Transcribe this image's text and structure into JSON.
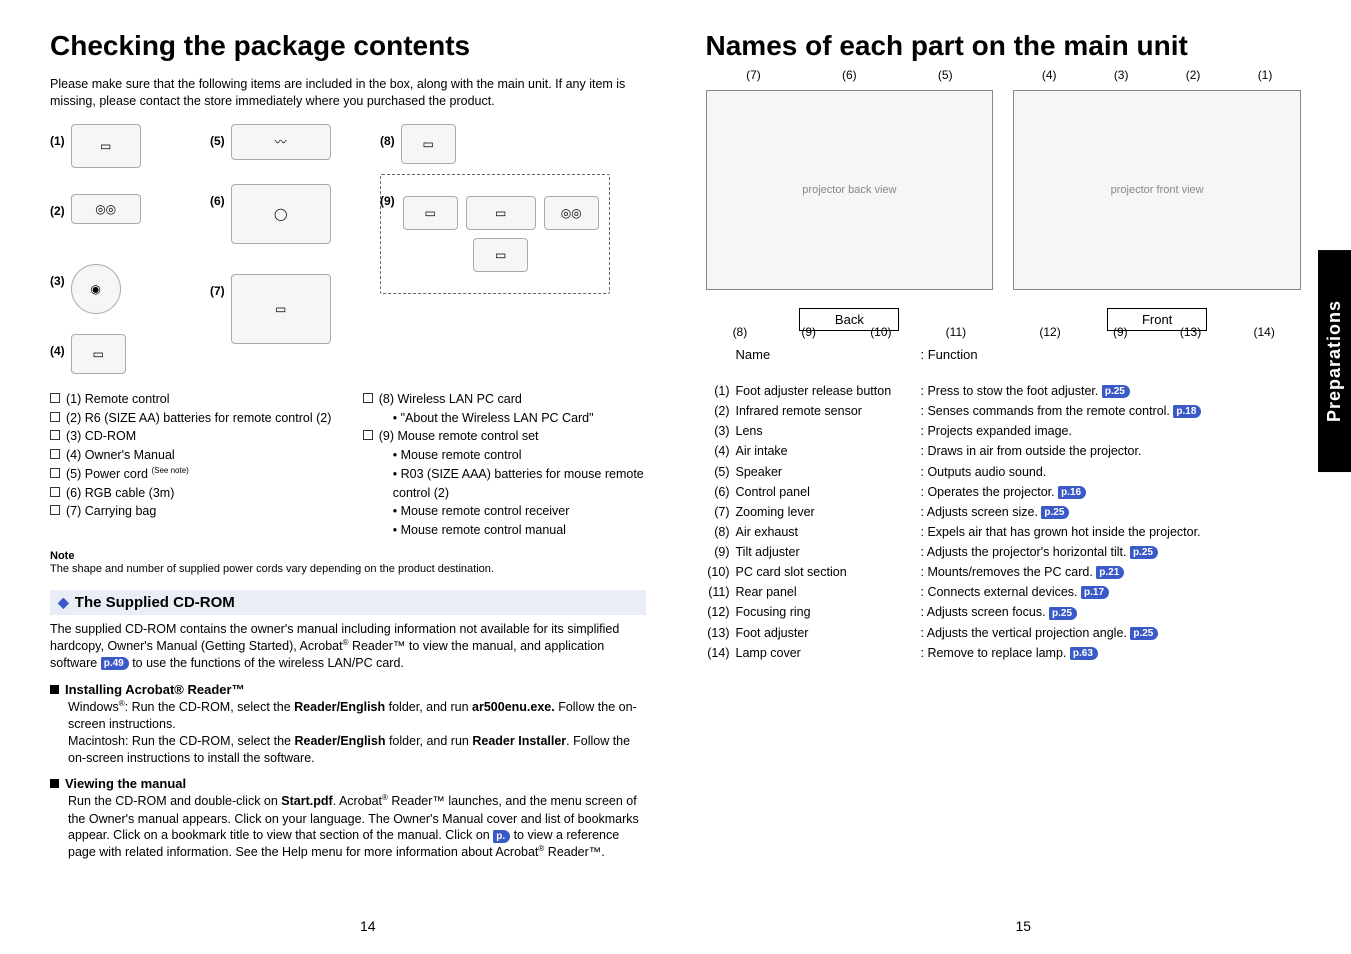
{
  "left": {
    "title": "Checking the package contents",
    "intro": "Please make sure that the following items are included in the box, along with the main unit. If any item is missing, please contact the store immediately where you purchased the product.",
    "pkg_nums": {
      "n1": "(1)",
      "n2": "(2)",
      "n3": "(3)",
      "n4": "(4)",
      "n5": "(5)",
      "n6": "(6)",
      "n7": "(7)",
      "n8": "(8)",
      "n9": "(9)"
    },
    "checklist_left": [
      {
        "label": "(1)  Remote control"
      },
      {
        "label": "(2)  R6 (SIZE AA) batteries for remote control (2)"
      },
      {
        "label": "(3)  CD-ROM"
      },
      {
        "label": "(4)  Owner's Manual"
      },
      {
        "label": "(5)  Power cord ",
        "super": "(See note)"
      },
      {
        "label": "(6)  RGB cable (3m)"
      },
      {
        "label": "(7)  Carrying bag"
      }
    ],
    "checklist_right": [
      {
        "label": "(8)  Wireless LAN PC card",
        "subs": [
          "• \"About the Wireless LAN PC Card\""
        ]
      },
      {
        "label": "(9)  Mouse remote control set",
        "subs": [
          "• Mouse remote control",
          "• R03 (SIZE AAA) batteries for mouse remote control (2)",
          "• Mouse remote control receiver",
          "• Mouse remote control manual"
        ]
      }
    ],
    "note_h": "Note",
    "note_t": "The shape and number of supplied power cords vary depending on the product destination.",
    "cd_section": {
      "title": "The Supplied CD-ROM",
      "body1a": "The supplied CD-ROM contains the owner's manual including information not available for its simplified hardcopy, Owner's Manual (Getting Started), Acrobat",
      "body1b": " Reader™ to view the manual, and application software ",
      "body1_ref": "p.49",
      "body1c": "  to use the functions of the wireless LAN/PC card.",
      "install_h": "Installing Acrobat® Reader™",
      "install_win": "Windows®: Run the CD-ROM, select the Reader/English folder, and run ar500enu.exe. Follow the on-screen instructions.",
      "install_mac": "Macintosh: Run the CD-ROM, select the Reader/English folder, and run Reader Installer. Follow the on-screen instructions to install the software.",
      "view_h": "Viewing the manual",
      "view_t1": "Run the CD-ROM and double-click on Start.pdf. Acrobat® Reader™ launches, and the menu screen of the Owner's manual appears. Click on your language. The Owner's Manual cover and list of bookmarks appear. Click on a bookmark title to view that section of the manual. Click on ",
      "view_ref": "p.  ",
      "view_t2": " to view a reference page with related information. See the Help menu for more information about Acrobat® Reader™."
    },
    "page_num": "14"
  },
  "right": {
    "title": "Names of each part on the main unit",
    "fig_back_top": [
      "(7)",
      "(6)",
      "(5)"
    ],
    "fig_back_bot": [
      "(8)",
      "(9)",
      "(10)",
      "(11)"
    ],
    "fig_front_top": [
      "(4)",
      "(3)",
      "(2)",
      "(1)"
    ],
    "fig_front_bot": [
      "(12)",
      "(9)",
      "(13)",
      "(14)"
    ],
    "label_back": "Back",
    "label_front": "Front",
    "head_name": "Name",
    "head_func": ": Function",
    "rows": [
      {
        "n": "(1)",
        "name": "Foot adjuster release button",
        "func": ": Press to stow the foot adjuster.",
        "ref": "p.25"
      },
      {
        "n": "(2)",
        "name": "Infrared remote sensor",
        "func": ": Senses commands from the remote control.",
        "ref": "p.18"
      },
      {
        "n": "(3)",
        "name": "Lens",
        "func": ": Projects expanded image."
      },
      {
        "n": "(4)",
        "name": "Air intake",
        "func": ": Draws in air from outside the projector."
      },
      {
        "n": "(5)",
        "name": "Speaker",
        "func": ": Outputs audio sound."
      },
      {
        "n": "(6)",
        "name": "Control panel",
        "func": ": Operates the projector.",
        "ref": "p.16"
      },
      {
        "n": "(7)",
        "name": "Zooming lever",
        "func": ": Adjusts screen size.",
        "ref": "p.25"
      },
      {
        "n": "(8)",
        "name": "Air exhaust",
        "func": ": Expels air that has grown hot inside the projector."
      },
      {
        "n": "(9)",
        "name": "Tilt adjuster",
        "func": ": Adjusts the projector's horizontal tilt.",
        "ref": "p.25"
      },
      {
        "n": "(10)",
        "name": "PC card slot section",
        "func": ": Mounts/removes the PC card.",
        "ref": "p.21"
      },
      {
        "n": "(11)",
        "name": "Rear panel",
        "func": ": Connects external devices.",
        "ref": "p.17"
      },
      {
        "n": "(12)",
        "name": "Focusing ring",
        "func": ": Adjusts screen focus.",
        "ref": "p.25"
      },
      {
        "n": "(13)",
        "name": "Foot adjuster",
        "func": ": Adjusts the vertical projection angle.",
        "ref": "p.25"
      },
      {
        "n": "(14)",
        "name": "Lamp cover",
        "func": ": Remove to replace lamp.",
        "ref": "p.63"
      }
    ],
    "side_tab": "Preparations",
    "page_num": "15"
  }
}
